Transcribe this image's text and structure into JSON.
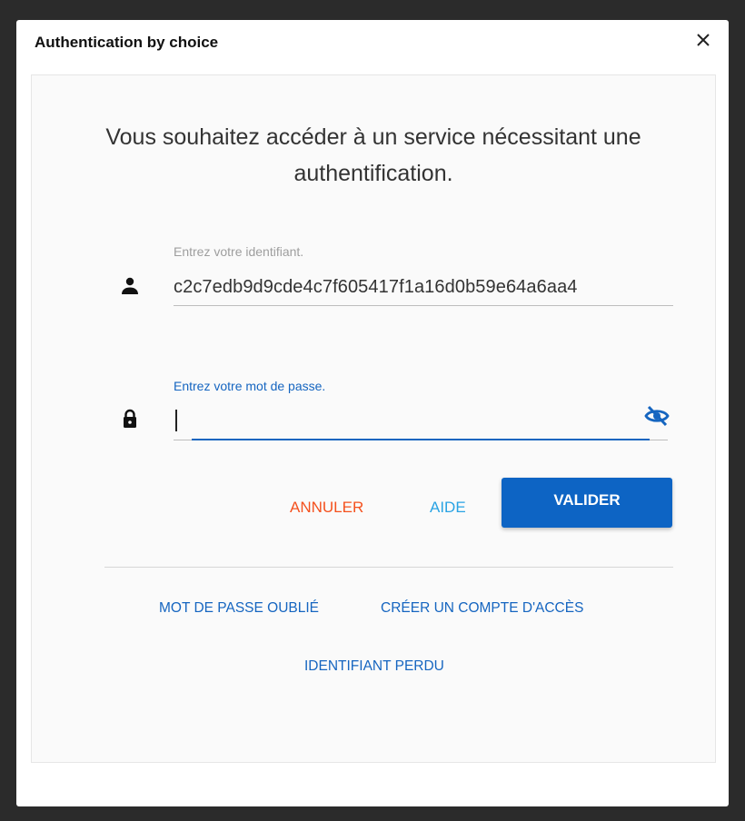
{
  "dialog": {
    "title": "Authentication by choice",
    "close_symbol": "×"
  },
  "form": {
    "heading": "Vous souhaitez accéder à un service nécessitant une authentification.",
    "username": {
      "label": "Entrez votre identifiant.",
      "value": "c2c7edb9d9cde4c7f605417f1a16d0b59e64a6aa4",
      "icon": "person-icon"
    },
    "password": {
      "label": "Entrez votre mot de passe.",
      "value": "",
      "icon": "lock-icon",
      "toggle_icon": "eye-off-icon"
    }
  },
  "actions": {
    "cancel_label": "ANNULER",
    "help_label": "AIDE",
    "submit_label": "VALIDER"
  },
  "links": {
    "forgot_password": "MOT DE PASSE OUBLIÉ",
    "create_account": "CRÉER UN COMPTE D'ACCÈS",
    "lost_identifier": "IDENTIFIANT PERDU"
  },
  "colors": {
    "primary": "#0d64c4",
    "cancel": "#f4511e",
    "help": "#29a3e4",
    "link": "#1565c0"
  }
}
